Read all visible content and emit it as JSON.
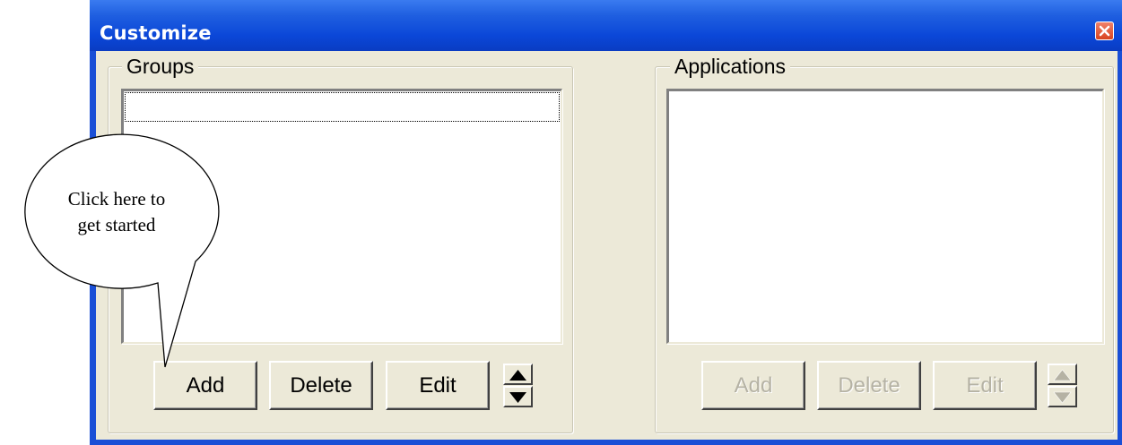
{
  "window": {
    "title": "Customize"
  },
  "groups": {
    "legend": "Groups",
    "buttons": {
      "add": "Add",
      "delete": "Delete",
      "edit": "Edit"
    }
  },
  "applications": {
    "legend": "Applications",
    "buttons": {
      "add": "Add",
      "delete": "Delete",
      "edit": "Edit"
    }
  },
  "callout": {
    "line1": "Click here to",
    "line2": "get started"
  },
  "icons": {
    "close": "close-icon",
    "move_up": "arrow-up-icon",
    "move_down": "arrow-down-icon"
  },
  "colors": {
    "titlebar": "#0a47d8",
    "close": "#d8431f",
    "dialog": "#ece9d8",
    "disabled_text": "#b5b2a4"
  }
}
